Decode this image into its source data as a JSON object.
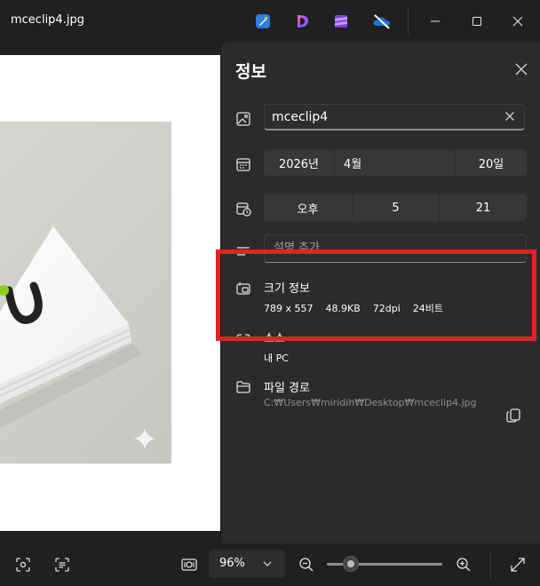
{
  "window": {
    "title": "mceclip4.jpg",
    "toolbar_icons": [
      "clipchamp-draw-icon",
      "designer-icon",
      "clipchamp-icon",
      "onedrive-off-icon"
    ],
    "controls": [
      "minimize-icon",
      "maximize-icon",
      "close-icon"
    ]
  },
  "info_panel": {
    "title": "정보",
    "file_name": "mceclip4",
    "date": {
      "year": "2026년",
      "month": "4월",
      "day": "20일"
    },
    "time": {
      "period": "오후",
      "hour": "5",
      "minute": "21"
    },
    "description_placeholder": "설명 추가",
    "size_info": {
      "label": "크기 정보",
      "dimensions": "789 x 557",
      "file_size": "48.9KB",
      "dpi": "72dpi",
      "bit_depth": "24비트"
    },
    "source": {
      "label": "소스",
      "value": "내 PC"
    },
    "file_path": {
      "label": "파일 경로",
      "value": "C:₩Users₩miridih₩Desktop₩mceclip4.jpg"
    }
  },
  "bottom_bar": {
    "zoom_value": "96%",
    "zoom_slider_fraction": 0.17,
    "icons": [
      "visual-search-icon",
      "text-scan-icon",
      "actual-size-icon",
      "zoom-out-icon",
      "zoom-in-icon",
      "fullscreen-icon"
    ]
  },
  "colors": {
    "background": "#202020",
    "panel": "#2b2b2b",
    "highlight": "#e12323"
  }
}
